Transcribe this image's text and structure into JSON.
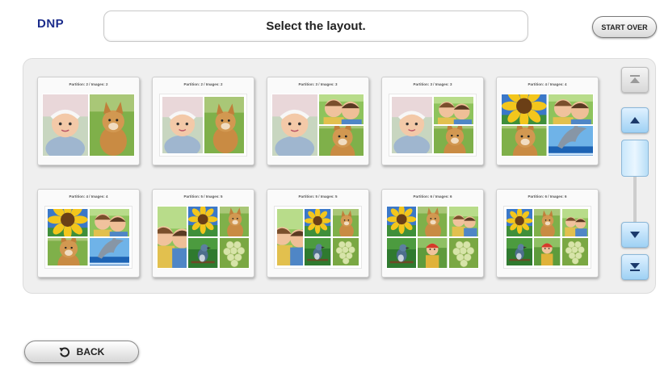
{
  "header": {
    "logo": "DNP",
    "title": "Select the layout.",
    "start_over_label": "START OVER"
  },
  "layouts": [
    {
      "label": "Partition: 2 / Images: 2",
      "kind": "l2",
      "framed": false,
      "photos": [
        "baby",
        "dog"
      ]
    },
    {
      "label": "Partition: 2 / Images: 2",
      "kind": "l2",
      "framed": true,
      "photos": [
        "baby",
        "dog"
      ]
    },
    {
      "label": "Partition: 3 / Images: 3",
      "kind": "l3",
      "framed": false,
      "photos": [
        "baby",
        "kids",
        "dog"
      ]
    },
    {
      "label": "Partition: 3 / Images: 3",
      "kind": "l3",
      "framed": true,
      "photos": [
        "baby",
        "kids",
        "dog"
      ]
    },
    {
      "label": "Partition: 4 / Images: 4",
      "kind": "l4",
      "framed": false,
      "photos": [
        "sunflower",
        "kids",
        "dog",
        "dolphin"
      ]
    },
    {
      "label": "Partition: 4 / Images: 4",
      "kind": "l4",
      "framed": true,
      "photos": [
        "sunflower",
        "kids",
        "dog",
        "dolphin"
      ]
    },
    {
      "label": "Partition: 5 / Images: 5",
      "kind": "l5",
      "framed": false,
      "photos": [
        "sunflower",
        "kids",
        "dog",
        "bird",
        "grapes"
      ]
    },
    {
      "label": "Partition: 5 / Images: 5",
      "kind": "l5",
      "framed": true,
      "photos": [
        "sunflower",
        "kids",
        "dog",
        "bird",
        "grapes"
      ]
    },
    {
      "label": "Partition: 6 / Images: 6",
      "kind": "l6",
      "framed": false,
      "photos": [
        "sunflower",
        "dog",
        "kids",
        "bird",
        "girl",
        "grapes"
      ]
    },
    {
      "label": "Partition: 6 / Images: 6",
      "kind": "l6",
      "framed": true,
      "photos": [
        "sunflower",
        "dog",
        "kids",
        "bird",
        "girl",
        "grapes"
      ]
    }
  ],
  "scroll": {
    "top_icon": "scroll-to-top-icon",
    "up_icon": "scroll-up-icon",
    "down_icon": "scroll-down-icon",
    "bottom_icon": "scroll-to-bottom-icon",
    "position": 0.0,
    "accent": "#9fd1f4"
  },
  "footer": {
    "back_label": "BACK",
    "back_icon": "back-arrow-icon"
  },
  "colors": {
    "brand": "#1c2d8c",
    "panel": "#efefef"
  }
}
